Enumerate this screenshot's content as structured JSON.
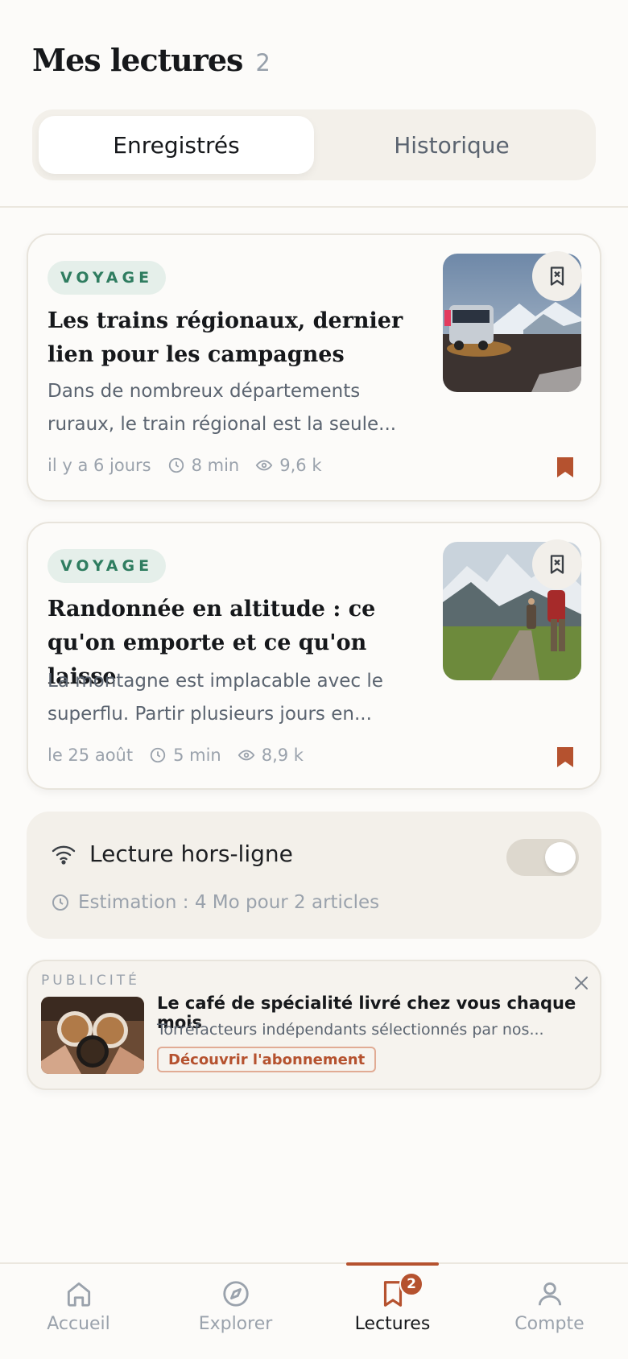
{
  "header": {
    "title": "Mes lectures",
    "count": "2"
  },
  "segments": {
    "saved": "Enregistrés",
    "history": "Historique"
  },
  "articles": [
    {
      "tag": "VOYAGE",
      "title": "Les trains régionaux, dernier lien pour les campagnes",
      "excerpt": "Dans de nombreux départements ruraux, le train régional est la seule...",
      "date": "il y a 6 jours",
      "read_time": "8 min",
      "views": "9,6 k"
    },
    {
      "tag": "VOYAGE",
      "title": "Randonnée en altitude : ce qu'on emporte et ce qu'on laisse",
      "excerpt": "La montagne est implacable avec le superflu. Partir plusieurs jours en...",
      "date": "le 25 août",
      "read_time": "5 min",
      "views": "8,9 k"
    }
  ],
  "offline": {
    "label": "Lecture hors-ligne",
    "estimate": "Estimation : 4 Mo pour 2 articles",
    "enabled": true
  },
  "ad": {
    "label": "PUBLICITÉ",
    "title": "Le café de spécialité livré chez vous chaque mois",
    "text": "Torréfacteurs indépendants sélectionnés par nos...",
    "cta": "Découvrir l'abonnement"
  },
  "nav": {
    "home": "Accueil",
    "explore": "Explorer",
    "readings": "Lectures",
    "readings_badge": "2",
    "account": "Compte"
  },
  "colors": {
    "accent": "#b5522f",
    "tag_bg": "#e5efea",
    "tag_text": "#2f7d60"
  },
  "icons": [
    "unsave-bookmark-icon",
    "bookmark-filled-icon",
    "clock-icon",
    "eye-icon",
    "wifi-icon",
    "close-icon",
    "home-icon",
    "compass-icon",
    "bookmark-icon",
    "user-icon"
  ]
}
